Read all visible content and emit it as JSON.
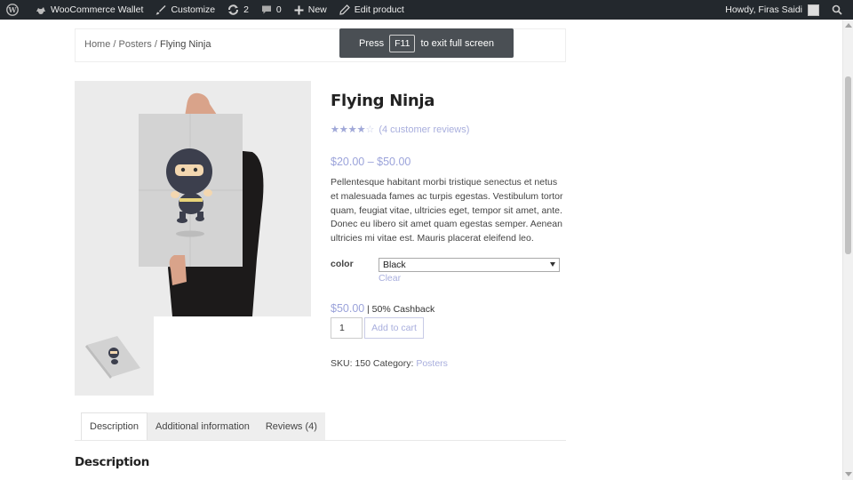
{
  "adminbar": {
    "items": [
      {
        "icon": "wordpress-icon",
        "label": ""
      },
      {
        "icon": "wallet-icon",
        "label": "WooCommerce Wallet"
      },
      {
        "icon": "brush-icon",
        "label": "Customize"
      },
      {
        "icon": "updates-icon",
        "label": "2"
      },
      {
        "icon": "comment-icon",
        "label": "0"
      },
      {
        "icon": "plus-icon",
        "label": "New"
      },
      {
        "icon": "pencil-icon",
        "label": "Edit product"
      }
    ],
    "greeting": "Howdy, Firas Saidi",
    "search_icon": "search-icon",
    "colors": {
      "bar_bg": "#23282d",
      "bar_text": "#eeeeee"
    }
  },
  "breadcrumb": {
    "home": "Home",
    "sep1": " / ",
    "category": "Posters",
    "sep2": " / ",
    "current": "Flying Ninja"
  },
  "fullscreen_notice": {
    "press": "Press",
    "key": "F11",
    "message": "to exit full screen"
  },
  "product": {
    "title": "Flying Ninja",
    "rating_fraction": 0.8,
    "review_link": "(4 customer reviews)",
    "price_range": "$20.00 – $50.00",
    "description": "Pellentesque habitant morbi tristique senectus et netus et malesuada fames ac turpis egestas. Vestibulum tortor quam, feugiat vitae, ultricies eget, tempor sit amet, ante. Donec eu libero sit amet quam egestas semper. Aenean ultricies mi vitae est. Mauris placerat eleifend leo.",
    "variation": {
      "label": "color",
      "selected": "Black",
      "clear": "Clear"
    },
    "variation_price": "$50.00",
    "cashback": "| 50% Cashback",
    "quantity": "1",
    "add_to_cart": "Add to cart",
    "meta": {
      "sku_label": "SKU: ",
      "sku": "150",
      "category_label": " Category: ",
      "category": "Posters"
    },
    "accent_color": "#a8aedd"
  },
  "tabs": [
    {
      "label": "Description",
      "active": true
    },
    {
      "label": "Additional information",
      "active": false
    },
    {
      "label": "Reviews (4)",
      "active": false
    }
  ],
  "section": {
    "title": "Description"
  }
}
